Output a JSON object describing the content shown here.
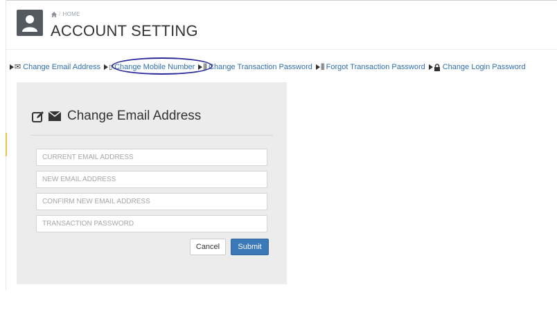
{
  "breadcrumb": {
    "home_icon": "home-icon",
    "label": "HOME"
  },
  "page": {
    "title": "ACCOUNT SETTING",
    "avatar_icon": "user-icon"
  },
  "nav": {
    "items": [
      {
        "label": "Change Email Address",
        "icon": "envelope-icon"
      },
      {
        "label": "Change Mobile Number",
        "icon": "mobile-icon",
        "highlighted": true
      },
      {
        "label": "Change Transaction Password",
        "icon": "barcode-icon"
      },
      {
        "label": "Forgot Transaction Password",
        "icon": "barcode-icon"
      },
      {
        "label": "Change Login Password",
        "icon": "lock-icon"
      }
    ]
  },
  "form": {
    "title": "Change Email Address",
    "icons": [
      "edit-icon",
      "envelope-icon"
    ],
    "fields": [
      {
        "placeholder": "CURRENT EMAIL ADDRESS",
        "value": ""
      },
      {
        "placeholder": "NEW EMAIL ADDRESS",
        "value": ""
      },
      {
        "placeholder": "CONFIRM NEW EMAIL ADDRESS",
        "value": ""
      },
      {
        "placeholder": "TRANSACTION PASSWORD",
        "value": ""
      }
    ],
    "cancel_label": "Cancel",
    "submit_label": "Submit"
  },
  "colors": {
    "link": "#2f6fb0",
    "submit": "#3a78b8",
    "panel": "#ececec",
    "highlight_ring": "#2a2a9a"
  }
}
